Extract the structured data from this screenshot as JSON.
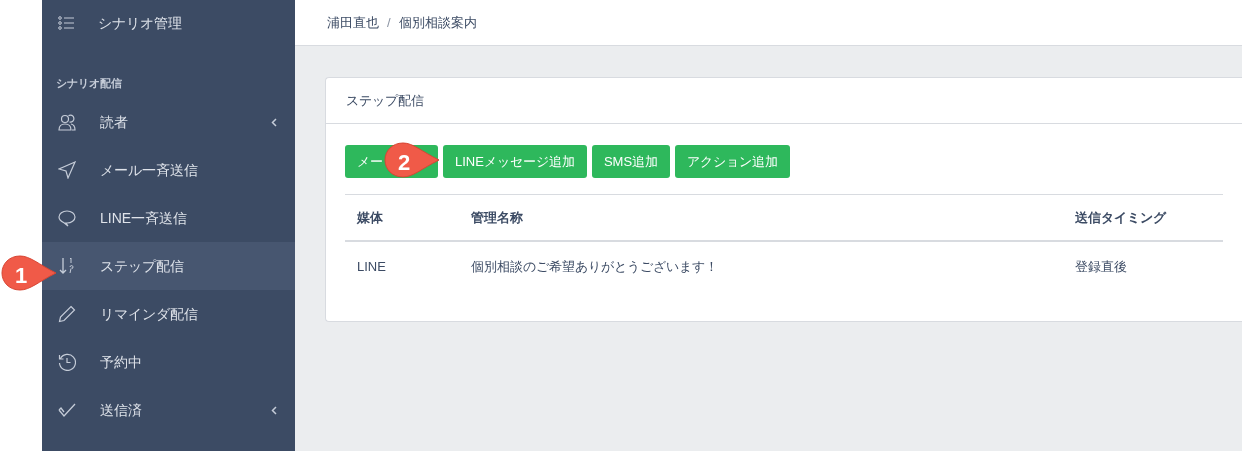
{
  "sidebar": {
    "top_item": {
      "label": "シナリオ管理"
    },
    "section_title": "シナリオ配信",
    "items": [
      {
        "label": "読者",
        "selected": false,
        "has_submenu": true
      },
      {
        "label": "メール一斉送信",
        "selected": false,
        "has_submenu": false
      },
      {
        "label": "LINE一斉送信",
        "selected": false,
        "has_submenu": false
      },
      {
        "label": "ステップ配信",
        "selected": true,
        "has_submenu": false
      },
      {
        "label": "リマインダ配信",
        "selected": false,
        "has_submenu": false
      },
      {
        "label": "予約中",
        "selected": false,
        "has_submenu": false
      },
      {
        "label": "送信済",
        "selected": false,
        "has_submenu": true
      }
    ]
  },
  "breadcrumb": {
    "items": [
      "浦田直也",
      "個別相談案内"
    ],
    "separator": "/"
  },
  "card": {
    "title": "ステップ配信",
    "buttons": [
      "メー",
      "LINEメッセージ追加",
      "SMS追加",
      "アクション追加"
    ],
    "table": {
      "columns": [
        "媒体",
        "管理名称",
        "送信タイミング"
      ],
      "rows": [
        [
          "LINE",
          "個別相談のご希望ありがとうございます！",
          "登録直後"
        ]
      ]
    }
  },
  "callouts": [
    {
      "number": "1"
    },
    {
      "number": "2"
    }
  ]
}
